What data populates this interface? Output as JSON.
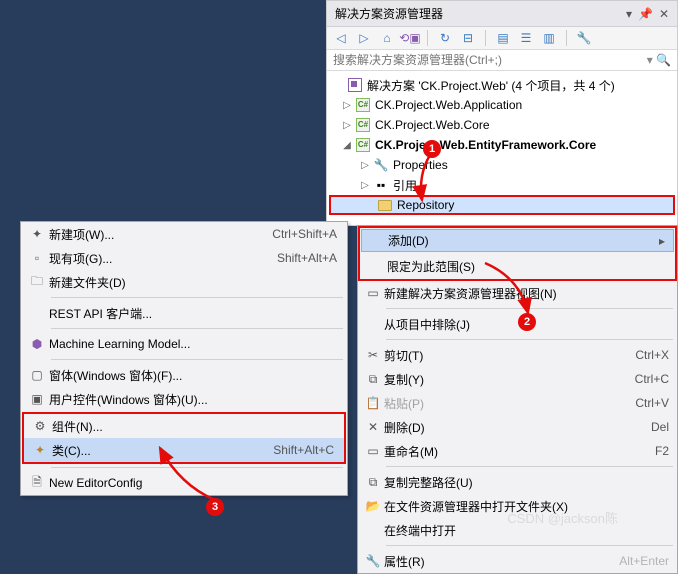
{
  "panel": {
    "title": "解决方案资源管理器",
    "search_placeholder": "搜索解决方案资源管理器(Ctrl+;)"
  },
  "tree": {
    "solution": "解决方案 'CK.Project.Web' (4 个项目，共 4 个)",
    "p1": "CK.Project.Web.Application",
    "p2": "CK.Project.Web.Core",
    "p3": "CK.Project.Web.EntityFramework.Core",
    "p3_props": "Properties",
    "p3_refs": "引用",
    "p3_repo": "Repository"
  },
  "ctxR": {
    "add": "添加(D)",
    "scope": "限定为此范围(S)",
    "newview": "新建解决方案资源管理器视图(N)",
    "exclude": "从项目中排除(J)",
    "cut": "剪切(T)",
    "cut_sc": "Ctrl+X",
    "copy": "复制(Y)",
    "copy_sc": "Ctrl+C",
    "paste": "粘贴(P)",
    "paste_sc": "Ctrl+V",
    "delete": "删除(D)",
    "delete_sc": "Del",
    "rename": "重命名(M)",
    "rename_sc": "F2",
    "copypath": "复制完整路径(U)",
    "openfolder": "在文件资源管理器中打开文件夹(X)",
    "terminal": "在终端中打开",
    "props": "属性(R)"
  },
  "ctxL": {
    "newitem": "新建项(W)...",
    "newitem_sc": "Ctrl+Shift+A",
    "existitem": "现有项(G)...",
    "existitem_sc": "Shift+Alt+A",
    "newfolder": "新建文件夹(D)",
    "restapi": "REST API 客户端...",
    "ml": "Machine Learning Model...",
    "winform": "窗体(Windows 窗体)(F)...",
    "usercontrol": "用户控件(Windows 窗体)(U)...",
    "component": "组件(N)...",
    "class": "类(C)...",
    "class_sc": "Shift+Alt+C",
    "editorconfig": "New EditorConfig"
  },
  "badges": {
    "b1": "1",
    "b2": "2",
    "b3": "3"
  },
  "watermark": "CSDN @jackson陈"
}
